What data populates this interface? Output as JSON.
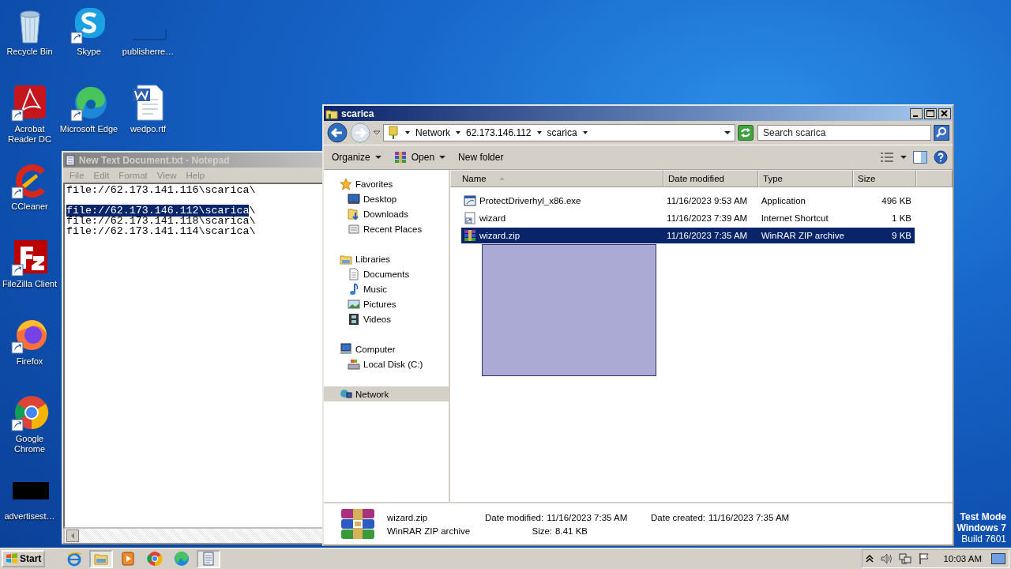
{
  "desktop_icons": [
    {
      "label": "Recycle Bin"
    },
    {
      "label": "Acrobat Reader DC"
    },
    {
      "label": "CCleaner"
    },
    {
      "label": "FileZilla Client"
    },
    {
      "label": "Firefox"
    },
    {
      "label": "Google Chrome"
    },
    {
      "label": "advertisest…"
    },
    {
      "label": "Skype"
    },
    {
      "label": "Microsoft Edge"
    },
    {
      "label": "publisherre…"
    },
    {
      "label": "wedpo.rtf"
    }
  ],
  "notepad": {
    "title": "New Text Document.txt - Notepad",
    "active": false,
    "menu": [
      "File",
      "Edit",
      "Format",
      "View",
      "Help"
    ],
    "lines": [
      {
        "kind": "text",
        "text": "file://62.173.141.116\\scarica\\"
      },
      {
        "kind": "blank"
      },
      {
        "kind": "text",
        "selected_text": "file://62.173.146.112\\scarica",
        "text": "\\"
      },
      {
        "kind": "text",
        "text": "file://62.173.141.118\\scarica\\"
      },
      {
        "kind": "text",
        "text": "file://62.173.141.114\\scarica\\"
      }
    ]
  },
  "explorer": {
    "title": "scarica",
    "active": true,
    "breadcrumbs": [
      "Network",
      "62.173.146.112",
      "scarica"
    ],
    "search": {
      "placeholder": "Search scarica"
    },
    "toolbar": [
      {
        "label": "Organize",
        "kind": "menu"
      },
      {
        "label": "Open",
        "kind": "open"
      },
      {
        "label": "New folder",
        "kind": "plain"
      }
    ],
    "nav": [
      {
        "label": "Favorites",
        "selected": false,
        "children": [
          {
            "label": "Desktop",
            "selected": false
          },
          {
            "label": "Downloads",
            "selected": false
          },
          {
            "label": "Recent Places",
            "selected": false
          }
        ]
      },
      {
        "label": "Libraries",
        "selected": false,
        "children": [
          {
            "label": "Documents",
            "selected": false
          },
          {
            "label": "Music",
            "selected": false
          },
          {
            "label": "Pictures",
            "selected": false
          },
          {
            "label": "Videos",
            "selected": false
          }
        ]
      },
      {
        "label": "Computer",
        "selected": false,
        "children": [
          {
            "label": "Local Disk (C:)",
            "selected": false
          }
        ]
      },
      {
        "label": "Network",
        "selected": true
      }
    ],
    "columns": [
      "Name",
      "Date modified",
      "Type",
      "Size"
    ],
    "files": [
      {
        "kind": "application",
        "name": "ProtectDriverhyl_x86.exe",
        "date": "11/16/2023 9:53 AM",
        "type": "Application",
        "size": "496 KB",
        "selected": false
      },
      {
        "kind": "shortcut",
        "name": "wizard",
        "date": "11/16/2023 7:39 AM",
        "type": "Internet Shortcut",
        "size": "1 KB",
        "selected": false
      },
      {
        "kind": "archive",
        "name": "wizard.zip",
        "date": "11/16/2023 7:35 AM",
        "type": "WinRAR ZIP archive",
        "size": "9 KB",
        "selected": true
      }
    ],
    "drag_selection": true,
    "details": {
      "name": "wizard.zip",
      "type": "WinRAR ZIP archive",
      "fields": [
        {
          "label": "Date modified:",
          "value": "11/16/2023 7:35 AM"
        },
        {
          "label": "Date created:",
          "value": "11/16/2023 7:35 AM"
        },
        {
          "label": "Size:",
          "value": "8.41 KB"
        }
      ]
    }
  },
  "test_mode": [
    "Test Mode",
    "Windows 7",
    "Build 7601"
  ],
  "taskbar": {
    "start": "Start",
    "apps": [
      {
        "selected": false
      },
      {
        "selected": true
      },
      {
        "selected": false
      },
      {
        "selected": false
      },
      {
        "selected": false
      },
      {
        "selected": true
      }
    ],
    "clock": "10:03 AM"
  }
}
